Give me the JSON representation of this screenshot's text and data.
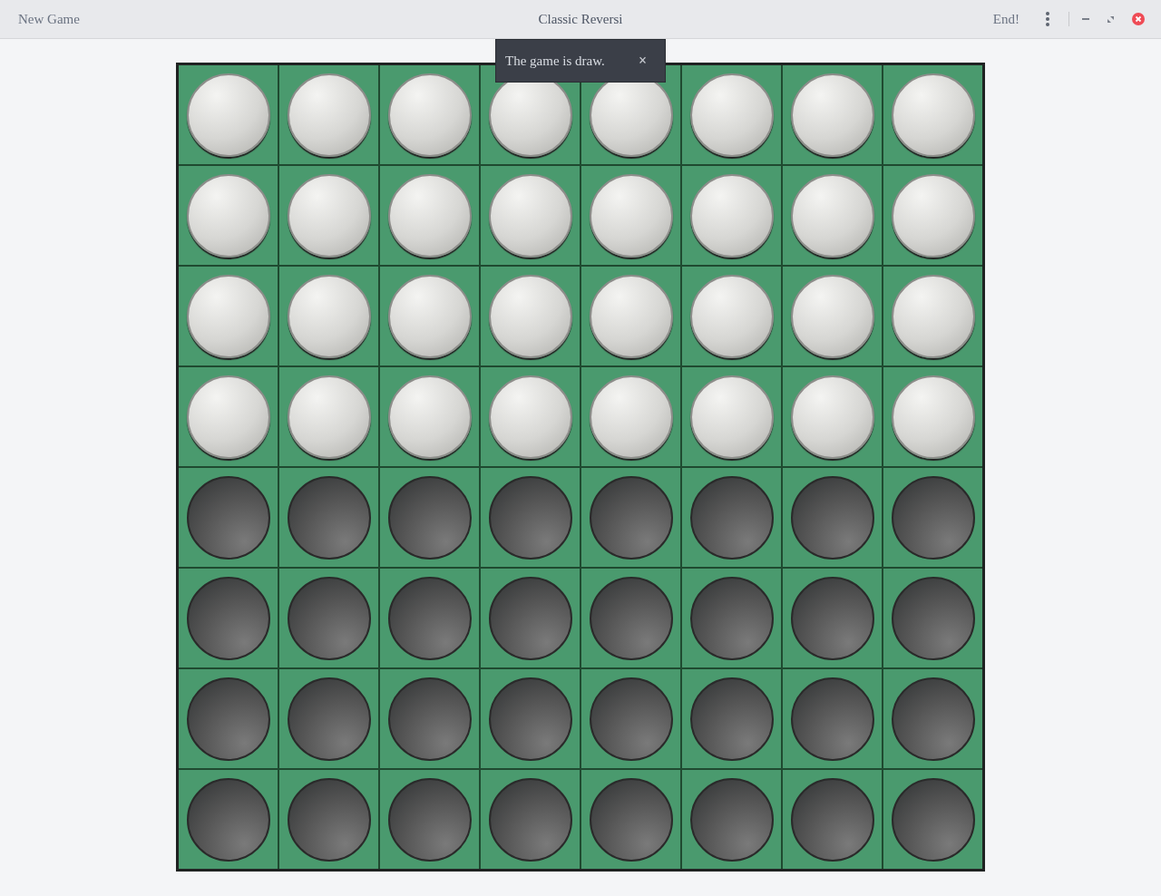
{
  "header_bar": {
    "new_game_button": "New Game",
    "title": "Classic Reversi",
    "end_button": "End!"
  },
  "notification": {
    "message": "The game is draw.",
    "close": "×"
  },
  "board": {
    "rows": [
      {
        "squares": [
          {
            "kind": "white"
          },
          {
            "kind": "white"
          },
          {
            "kind": "white"
          },
          {
            "kind": "white"
          },
          {
            "kind": "white"
          },
          {
            "kind": "white"
          },
          {
            "kind": "white"
          },
          {
            "kind": "white"
          }
        ]
      },
      {
        "squares": [
          {
            "kind": "white"
          },
          {
            "kind": "white"
          },
          {
            "kind": "white"
          },
          {
            "kind": "white"
          },
          {
            "kind": "white"
          },
          {
            "kind": "white"
          },
          {
            "kind": "white"
          },
          {
            "kind": "white"
          }
        ]
      },
      {
        "squares": [
          {
            "kind": "white"
          },
          {
            "kind": "white"
          },
          {
            "kind": "white"
          },
          {
            "kind": "white"
          },
          {
            "kind": "white"
          },
          {
            "kind": "white"
          },
          {
            "kind": "white"
          },
          {
            "kind": "white"
          }
        ]
      },
      {
        "squares": [
          {
            "kind": "white"
          },
          {
            "kind": "white"
          },
          {
            "kind": "white"
          },
          {
            "kind": "white"
          },
          {
            "kind": "white"
          },
          {
            "kind": "white"
          },
          {
            "kind": "white"
          },
          {
            "kind": "white"
          }
        ]
      },
      {
        "squares": [
          {
            "kind": "black"
          },
          {
            "kind": "black"
          },
          {
            "kind": "black"
          },
          {
            "kind": "black"
          },
          {
            "kind": "black"
          },
          {
            "kind": "black"
          },
          {
            "kind": "black"
          },
          {
            "kind": "black"
          }
        ]
      },
      {
        "squares": [
          {
            "kind": "black"
          },
          {
            "kind": "black"
          },
          {
            "kind": "black"
          },
          {
            "kind": "black"
          },
          {
            "kind": "black"
          },
          {
            "kind": "black"
          },
          {
            "kind": "black"
          },
          {
            "kind": "black"
          }
        ]
      },
      {
        "squares": [
          {
            "kind": "black"
          },
          {
            "kind": "black"
          },
          {
            "kind": "black"
          },
          {
            "kind": "black"
          },
          {
            "kind": "black"
          },
          {
            "kind": "black"
          },
          {
            "kind": "black"
          },
          {
            "kind": "black"
          }
        ]
      },
      {
        "squares": [
          {
            "kind": "black"
          },
          {
            "kind": "black"
          },
          {
            "kind": "black"
          },
          {
            "kind": "black"
          },
          {
            "kind": "black"
          },
          {
            "kind": "black"
          },
          {
            "kind": "black"
          },
          {
            "kind": "black"
          }
        ]
      }
    ]
  }
}
